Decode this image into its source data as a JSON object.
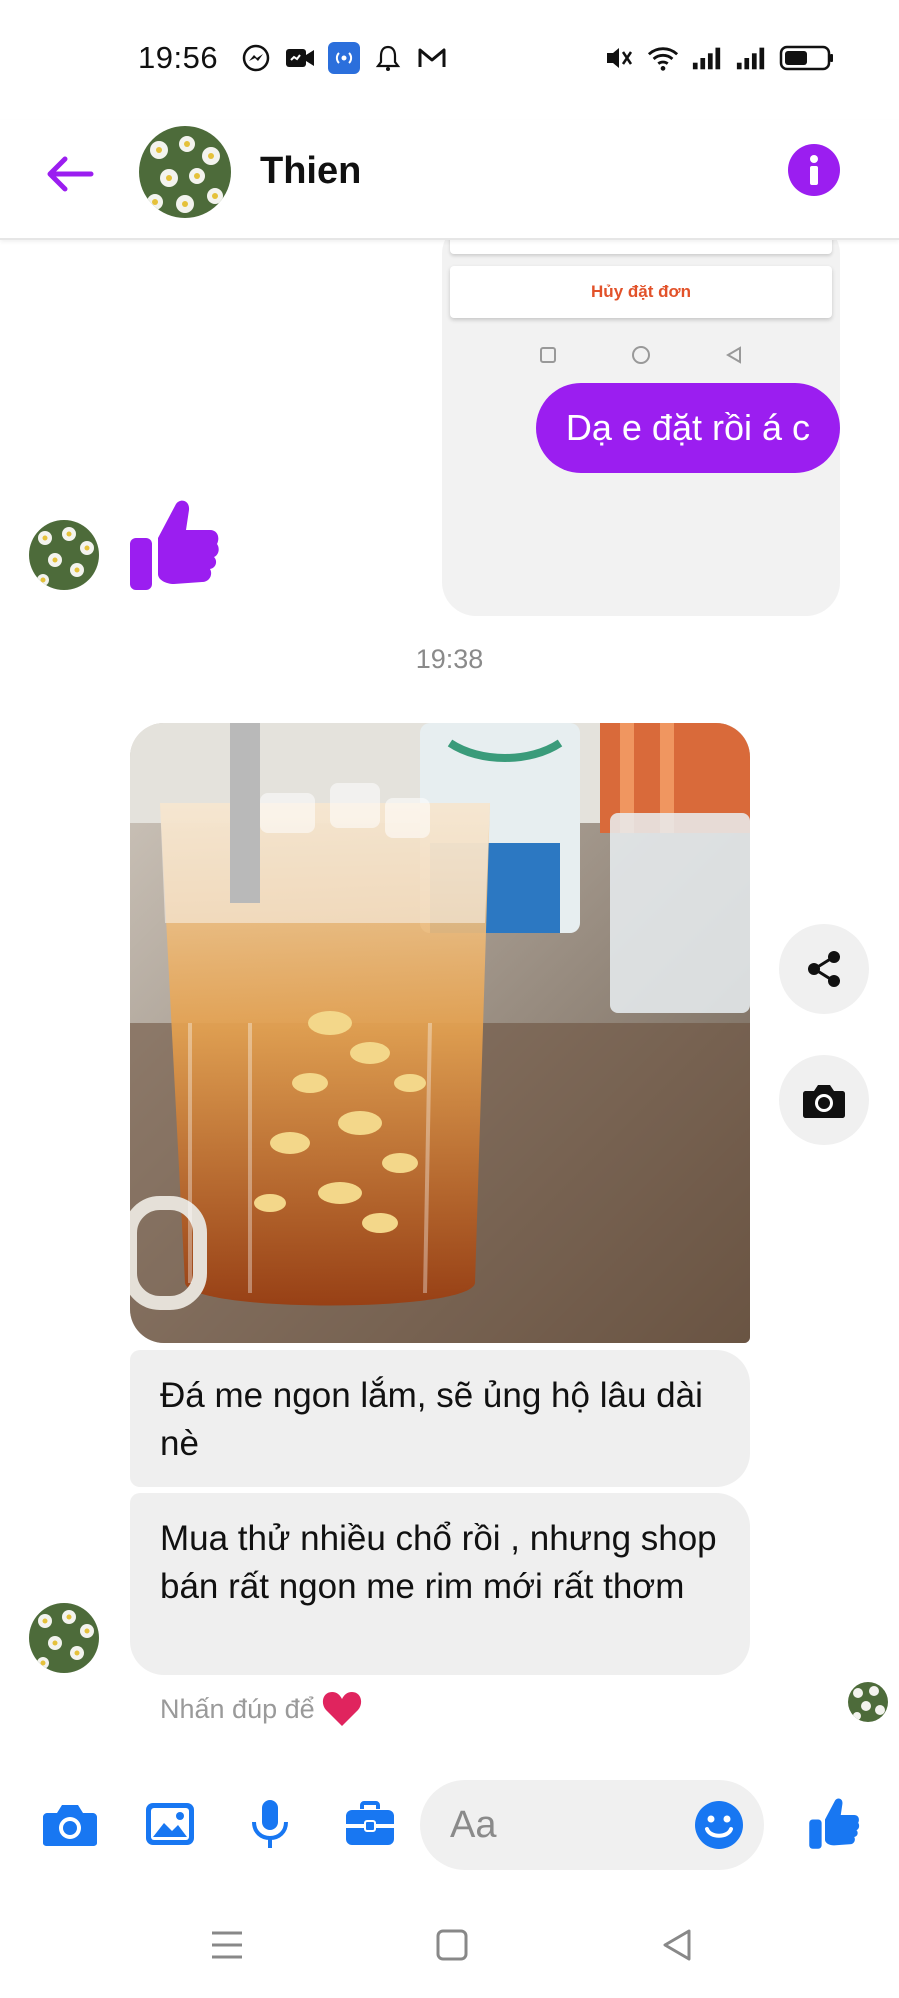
{
  "status_bar": {
    "time": "19:56"
  },
  "header": {
    "contact_name": "Thien"
  },
  "snippet": {
    "button_label": "Hủy đặt đơn"
  },
  "messages": {
    "outgoing_1": "Dạ e đặt rồi á c",
    "timestamp": "19:38",
    "incoming_1": "Đá me ngon lắm, sẽ ủng hộ lâu dài nè",
    "incoming_2": "Mua thử nhiều chổ rồi , nhưng shop bán rất ngon me rim mới rất thơm",
    "double_tap_hint": "Nhấn đúp để"
  },
  "composer": {
    "placeholder": "Aa"
  },
  "colors": {
    "accent_purple": "#9b1ef0",
    "messenger_blue": "#1877f2",
    "bubble_gray": "#efefef",
    "heart_red": "#e0245e"
  },
  "icons": [
    "messenger-icon",
    "video-icon",
    "hotspot-icon",
    "bell-icon",
    "gmail-icon",
    "mute-icon",
    "wifi-icon",
    "signal-icon",
    "battery-icon",
    "back-arrow-icon",
    "info-icon",
    "thumbs-up-icon",
    "share-icon",
    "camera-icon",
    "gallery-icon",
    "mic-icon",
    "briefcase-icon",
    "emoji-icon",
    "heart-icon"
  ]
}
